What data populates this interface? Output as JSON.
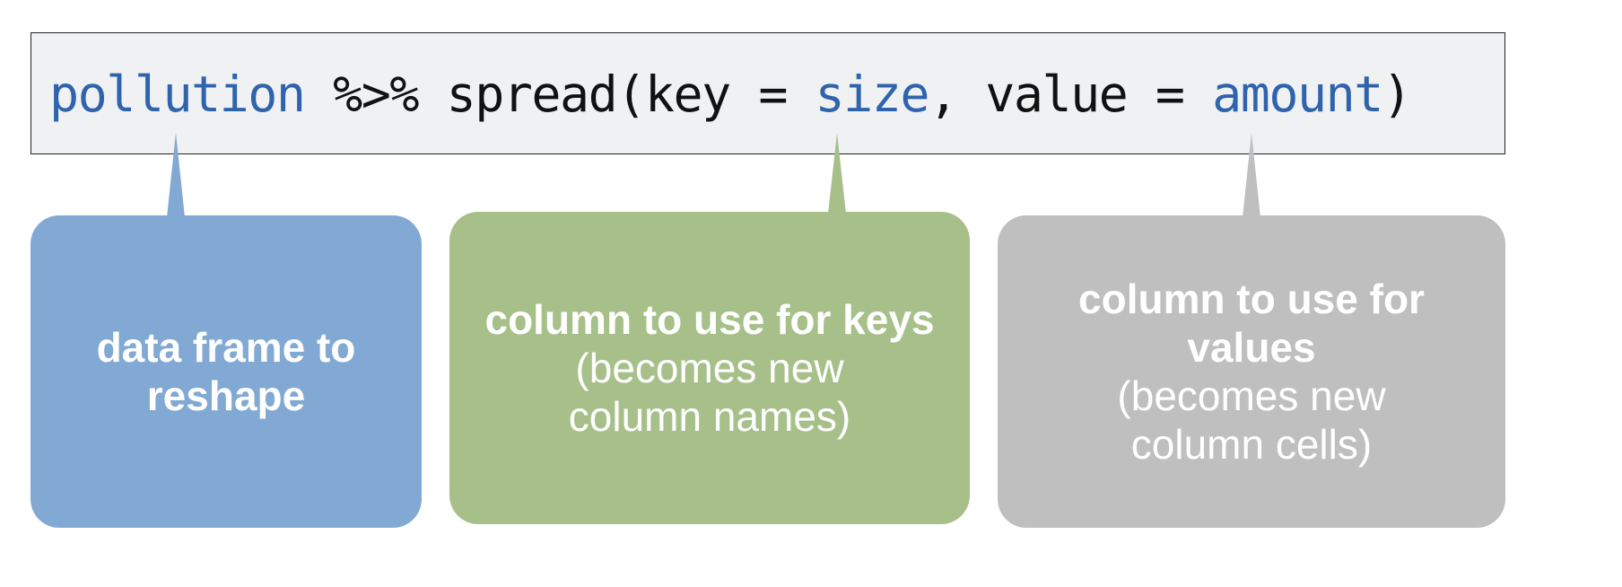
{
  "code": {
    "tokens": [
      {
        "text": "pollution",
        "style": "blue"
      },
      {
        "text": " %>% spread(key = ",
        "style": "plain"
      },
      {
        "text": "size",
        "style": "blue"
      },
      {
        "text": ", value = ",
        "style": "plain"
      },
      {
        "text": "amount",
        "style": "blue"
      },
      {
        "text": ")",
        "style": "plain"
      }
    ]
  },
  "callouts": {
    "data_frame": {
      "bold": "data frame to reshape",
      "normal": "",
      "color": "#81a9d4"
    },
    "key": {
      "bold": "column to use for keys",
      "normal": "(becomes new column names)",
      "color": "#a7c08a"
    },
    "value": {
      "bold": "column to use for values",
      "normal": "(becomes new column cells)",
      "color": "#bfbfbf"
    }
  },
  "colors": {
    "code_background": "#f0f1f3",
    "code_highlight": "#2f64ad",
    "code_text": "#111111"
  }
}
